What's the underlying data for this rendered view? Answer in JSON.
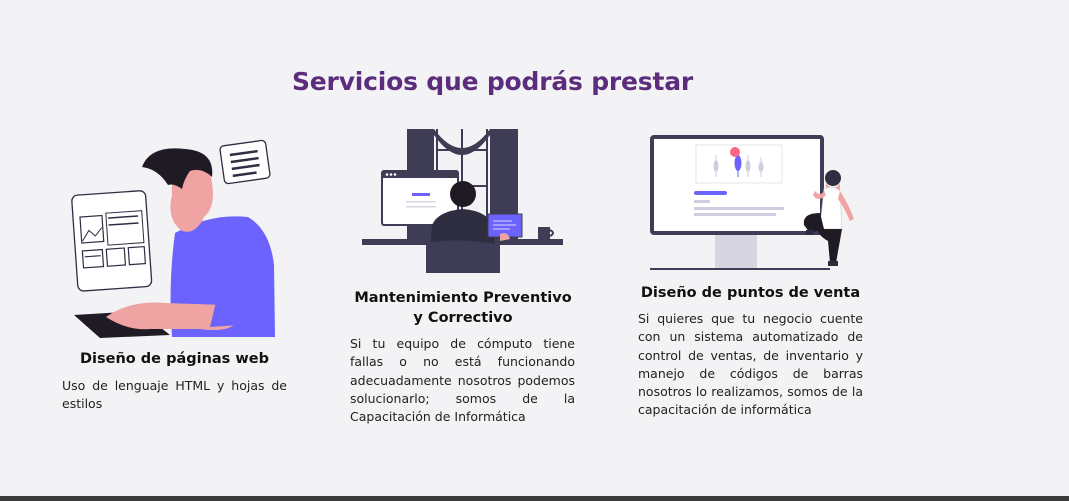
{
  "section": {
    "title": "Servicios que podrás prestar"
  },
  "services": [
    {
      "icon": "web-developer-illustration",
      "title": "Diseño de páginas web",
      "description": "Uso de lenguaje HTML y hojas de estilos"
    },
    {
      "icon": "computer-maintenance-illustration",
      "title": "Mantenimiento Preventivo y Correctivo",
      "description": "Si tu equipo de cómputo tiene fallas o no está funcionando adecuadamente nosotros podemos solucionarlo; somos de la Capacitación de Informática"
    },
    {
      "icon": "point-of-sale-illustration",
      "title": "Diseño de puntos de venta",
      "description": "Si quieres que tu negocio cuente con un sistema automatizado de control de ventas, de inventario y manejo de códigos de barras nosotros lo realizamos, somos de la capacitación de informática"
    }
  ],
  "colors": {
    "title": "#5b2d7c",
    "accent": "#6c63ff",
    "dark": "#3f3d56",
    "skin": "#f0a3a3",
    "hair": "#1f1a24",
    "background": "#f3f2f4"
  }
}
